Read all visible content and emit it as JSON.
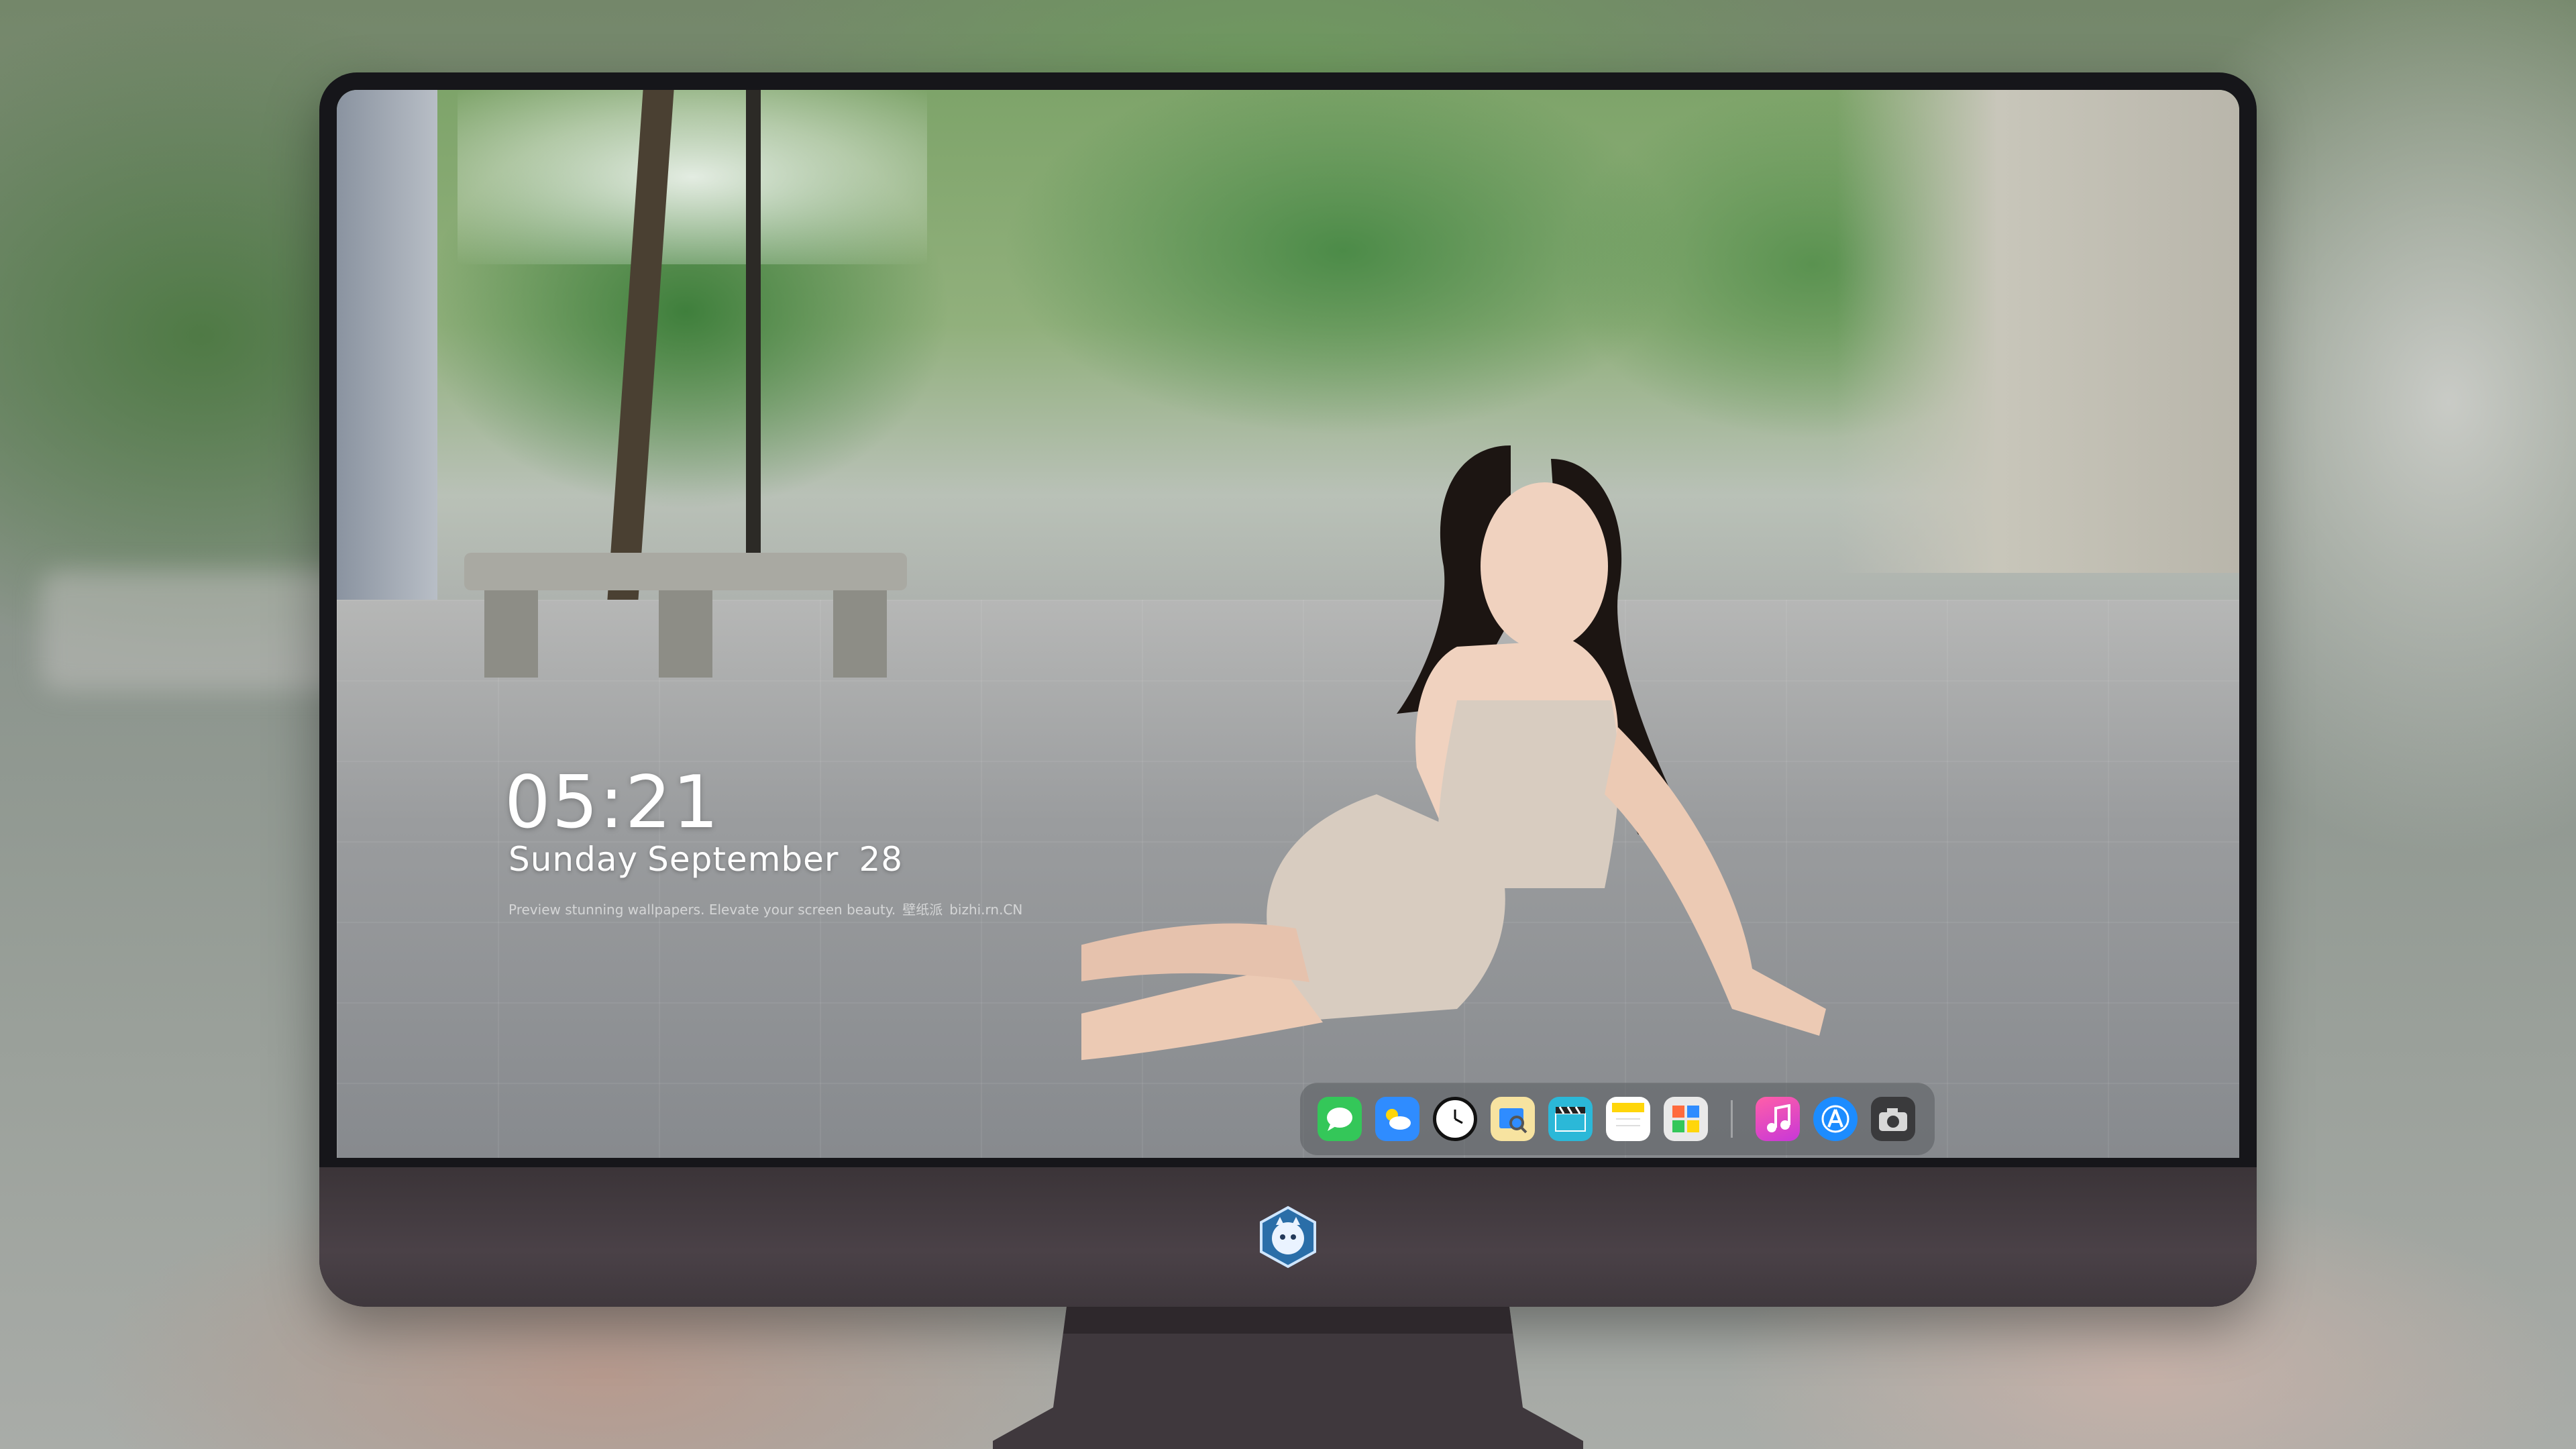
{
  "lockscreen": {
    "time": "05:21",
    "date_weekday": "Sunday",
    "date_month": "September",
    "date_day": "28",
    "tagline_text": "Preview stunning wallpapers. Elevate your screen beauty.",
    "tagline_chinese": "壁纸派",
    "tagline_site": "bizhi.rn.CN"
  },
  "dock": {
    "items": [
      {
        "name": "Messages",
        "icon": "message-bubble-icon",
        "color": "#34c759"
      },
      {
        "name": "Weather",
        "icon": "cloud-sun-icon",
        "color": "#2f8cff"
      },
      {
        "name": "Clock",
        "icon": "clock-icon",
        "color": "#111111"
      },
      {
        "name": "Preview",
        "icon": "preview-icon",
        "color": "#f2c94c"
      },
      {
        "name": "Clips",
        "icon": "clapperboard-icon",
        "color": "#2bb8d8"
      },
      {
        "name": "Notes",
        "icon": "notes-icon",
        "color": "#ffd60a"
      },
      {
        "name": "Photo Booth",
        "icon": "photo-grid-icon",
        "color": "#e9e9e9"
      },
      {
        "name": "Music",
        "icon": "music-note-icon",
        "color": "#ff3fa4"
      },
      {
        "name": "App Store",
        "icon": "app-store-icon",
        "color": "#1c8cff"
      },
      {
        "name": "Camera",
        "icon": "camera-icon",
        "color": "#3a3a3c"
      }
    ]
  },
  "colors": {
    "bezel": "#16161a",
    "chin": "#433b40",
    "dock_bg": "#5a5c60"
  }
}
